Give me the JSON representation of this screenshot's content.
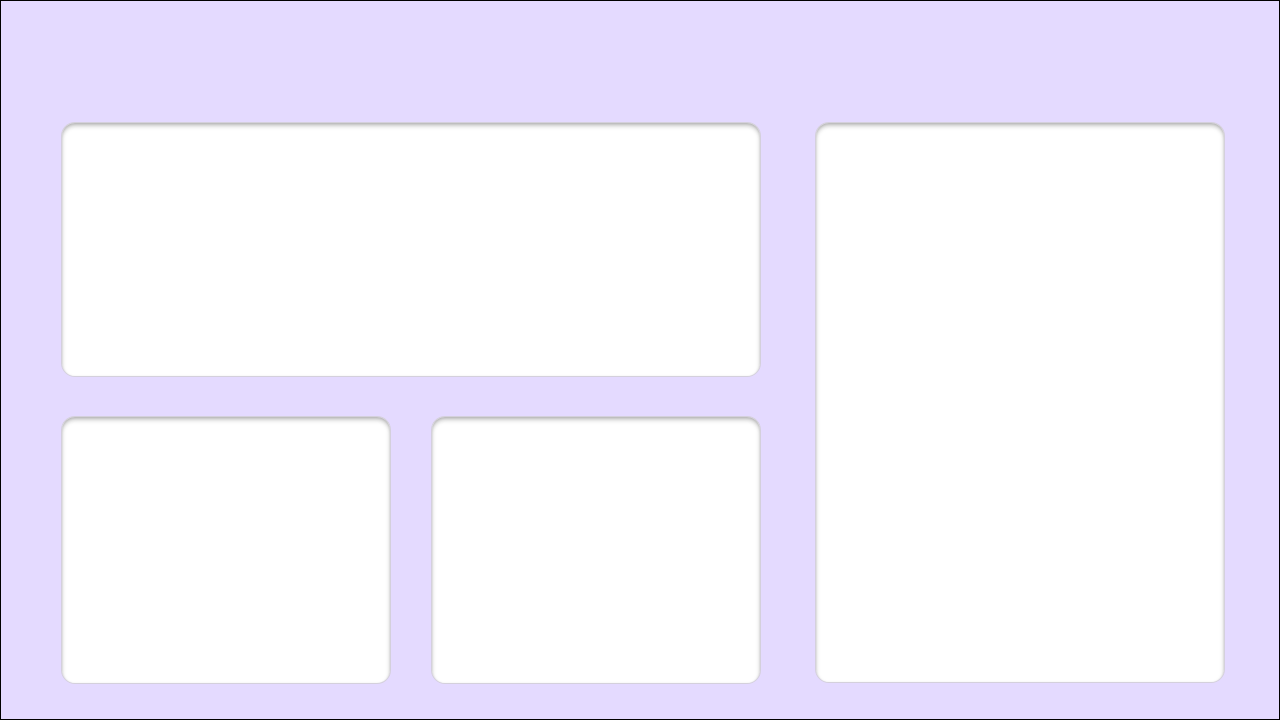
{
  "colors": {
    "background": "#e4daff",
    "panel": "#ffffff",
    "frame_border": "#000000"
  },
  "panels": [
    {
      "id": "top-wide",
      "content": ""
    },
    {
      "id": "bottom-left",
      "content": ""
    },
    {
      "id": "bottom-middle",
      "content": ""
    },
    {
      "id": "right-tall",
      "content": ""
    }
  ]
}
